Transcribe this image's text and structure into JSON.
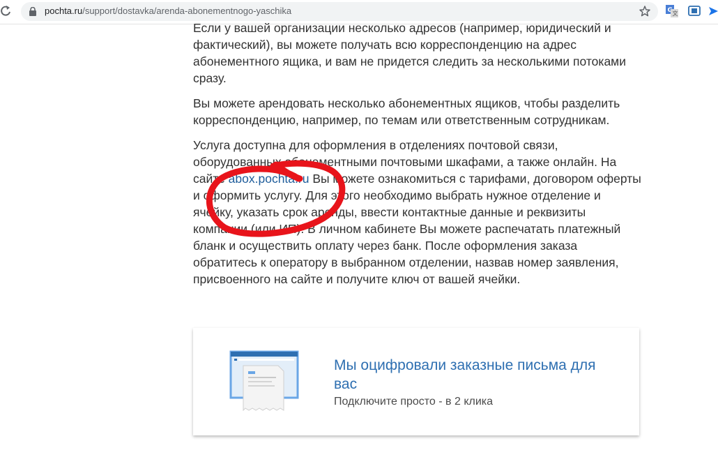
{
  "browser": {
    "url_host": "pochta.ru",
    "url_path": "/support/dostavka/arenda-abonementnogo-yaschika"
  },
  "article": {
    "p1": "Если у вашей организации несколько адресов (например, юридический и фактический), вы можете получать всю корреспонденцию на адрес абонементного ящика, и вам не придется следить за несколькими потоками сразу.",
    "p2": "Вы можете арендовать несколько абонементных ящиков, чтобы разделить корреспонденцию, например, по темам или ответственным сотрудникам.",
    "p3_before": "Услуга доступна для оформления в отделениях почтовой связи, оборудованных абонементными почтовыми шкафами, а также онлайн. На сайте ",
    "p3_link": "abox.pochta.ru",
    "p3_after": " Вы можете ознакомиться с тарифами, договором оферты и оформить услугу. Для этого необходимо выбрать нужное отделение и ячейку, указать срок аренды, ввести контактные данные и реквизиты компании (или ИП). В личном кабинете Вы можете распечатать платежный бланк и осуществить оплату через банк. После оформления заказа обратитесь к оператору в выбранном отделении, назвав номер заявления, присвоенного на сайте и получите ключ от вашей ячейки."
  },
  "banner": {
    "title": "Мы оцифровали заказные письма для вас",
    "subtitle": "Подключите просто - в 2 клика"
  },
  "colors": {
    "link": "#1f5d9b",
    "banner_title": "#2e6fb1",
    "annotation": "#e8141b"
  }
}
